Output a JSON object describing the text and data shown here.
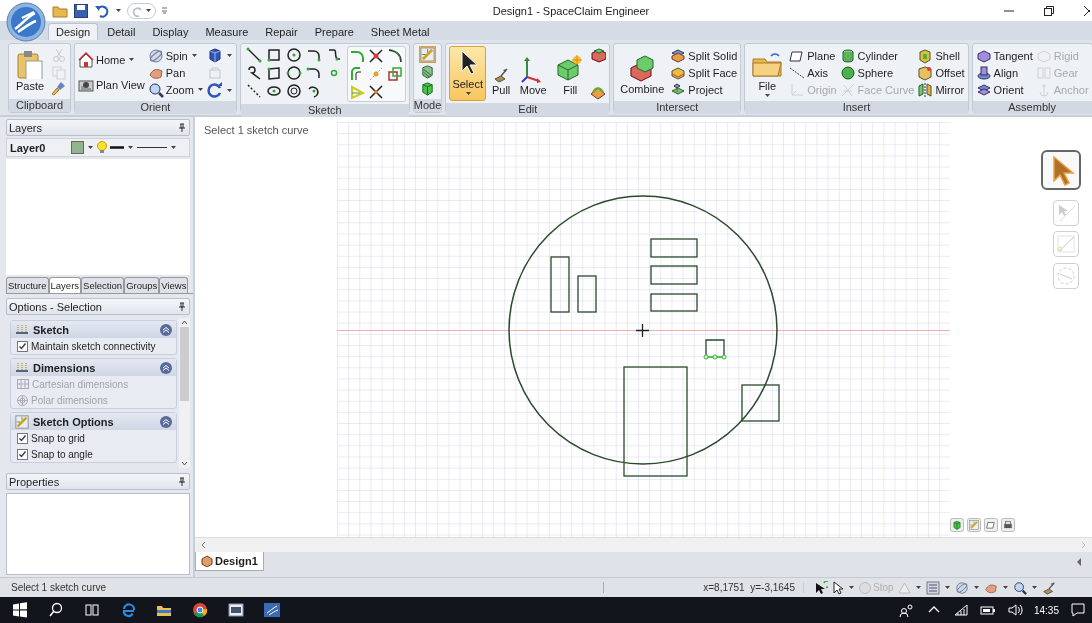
{
  "window": {
    "title": "Design1 - SpaceClaim Engineer"
  },
  "ribbon_tabs": [
    {
      "label": "Design",
      "selected": true
    },
    {
      "label": "Detail",
      "selected": false
    },
    {
      "label": "Display",
      "selected": false
    },
    {
      "label": "Measure",
      "selected": false
    },
    {
      "label": "Repair",
      "selected": false
    },
    {
      "label": "Prepare",
      "selected": false
    },
    {
      "label": "Sheet Metal",
      "selected": false
    }
  ],
  "ribbon_groups": [
    {
      "label": "Clipboard",
      "buttons": [
        {
          "label": "Paste"
        }
      ],
      "icon_buttons": [
        {
          "disabled": true
        },
        {
          "disabled": true
        },
        {
          "disabled": false
        }
      ]
    },
    {
      "label": "Orient",
      "buttons": [
        {
          "label": "Home",
          "dropdown": true
        },
        {
          "label": "Plan View",
          "dropdown": false
        },
        {
          "label": "Spin",
          "dropdown": true
        },
        {
          "label": "Pan",
          "dropdown": false
        },
        {
          "label": "Zoom",
          "dropdown": true
        }
      ]
    },
    {
      "label": "Sketch"
    },
    {
      "label": "Mode",
      "modes": [
        {
          "selected": true
        },
        {
          "selected": false
        },
        {
          "selected": false
        }
      ]
    },
    {
      "label": "Edit",
      "buttons": [
        {
          "label": "Select",
          "selected": true
        },
        {
          "label": "Pull",
          "selected": false
        },
        {
          "label": "Move",
          "selected": false
        },
        {
          "label": "Fill",
          "selected": false
        }
      ]
    },
    {
      "label": "Intersect",
      "buttons": [
        {
          "label": "Combine"
        },
        {
          "label": "Split Solid"
        },
        {
          "label": "Split Face"
        },
        {
          "label": "Project"
        }
      ]
    },
    {
      "label": "Insert",
      "buttons": [
        {
          "label": "File",
          "disabled": false
        },
        {
          "label": "Plane",
          "disabled": false
        },
        {
          "label": "Axis",
          "disabled": false
        },
        {
          "label": "Origin",
          "disabled": true
        },
        {
          "label": "Cylinder",
          "disabled": false
        },
        {
          "label": "Sphere",
          "disabled": false
        },
        {
          "label": "Face Curve",
          "disabled": true
        },
        {
          "label": "Shell",
          "disabled": false
        },
        {
          "label": "Offset",
          "disabled": false
        },
        {
          "label": "Mirror",
          "disabled": false
        }
      ]
    },
    {
      "label": "Assembly",
      "buttons": [
        {
          "label": "Tangent",
          "disabled": false
        },
        {
          "label": "Align",
          "disabled": false
        },
        {
          "label": "Orient",
          "disabled": false
        },
        {
          "label": "Rigid",
          "disabled": true
        },
        {
          "label": "Gear",
          "disabled": true
        },
        {
          "label": "Anchor",
          "disabled": true
        }
      ]
    }
  ],
  "layers_panel": {
    "title": "Layers",
    "layers": [
      {
        "name": "Layer0",
        "color": "#8fb48f"
      }
    ]
  },
  "panel_tabs": [
    {
      "label": "Structure",
      "selected": false
    },
    {
      "label": "Layers",
      "selected": true
    },
    {
      "label": "Selection",
      "selected": false
    },
    {
      "label": "Groups",
      "selected": false
    },
    {
      "label": "Views",
      "selected": false
    }
  ],
  "options_panel": {
    "title": "Options - Selection",
    "sections": [
      {
        "title": "Sketch",
        "options": [
          {
            "label": "Maintain sketch connectivity",
            "kind": "checkbox",
            "checked": true,
            "disabled": false
          }
        ]
      },
      {
        "title": "Dimensions",
        "options": [
          {
            "label": "Cartesian dimensions",
            "kind": "cartesian",
            "disabled": true
          },
          {
            "label": "Polar dimensions",
            "kind": "polar",
            "disabled": true
          }
        ]
      },
      {
        "title": "Sketch Options",
        "options": [
          {
            "label": "Snap to grid",
            "kind": "checkbox",
            "checked": true,
            "disabled": false
          },
          {
            "label": "Snap to angle",
            "kind": "checkbox",
            "checked": true,
            "disabled": false
          }
        ]
      }
    ]
  },
  "properties_panel": {
    "title": "Properties"
  },
  "canvas": {
    "hint": "Select 1 sketch curve",
    "curves": [
      {
        "kind": "circle",
        "selected": false
      },
      {
        "kind": "rect",
        "selected": false
      },
      {
        "kind": "rect",
        "selected": false
      },
      {
        "kind": "rect",
        "selected": false
      },
      {
        "kind": "rect",
        "selected": false
      },
      {
        "kind": "rect",
        "selected": false
      },
      {
        "kind": "rect",
        "selected": false
      },
      {
        "kind": "rect",
        "selected": false
      },
      {
        "kind": "rect",
        "selected": true
      }
    ]
  },
  "document_tabs": [
    {
      "label": "Design1",
      "selected": true
    }
  ],
  "status_bar": {
    "message": "Select 1 sketch curve",
    "coordinates": "x=8,1751  y=-3,1645",
    "stop_label": "Stop"
  },
  "taskbar": {
    "time": "14:35"
  }
}
